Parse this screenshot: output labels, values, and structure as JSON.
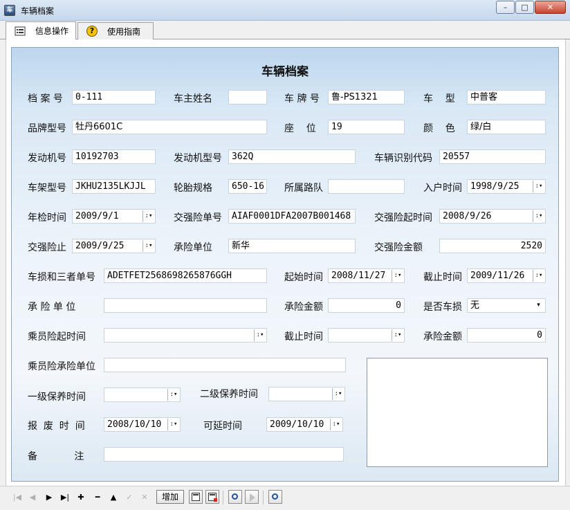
{
  "window": {
    "title": "车辆档案",
    "app_icon_text": "车",
    "minimize": "–",
    "maximize": "□",
    "close": "✕"
  },
  "tabs": [
    {
      "label": "信息操作",
      "icon": "list-icon"
    },
    {
      "label": "使用指南",
      "icon": "help-icon",
      "icon_glyph": "?"
    }
  ],
  "form": {
    "title": "车辆档案",
    "labels": {
      "file_no": "档 案 号",
      "owner_name": "车主姓名",
      "plate_no": "车 牌 号",
      "car_type": "车    型",
      "brand_model": "品牌型号",
      "seats": "座    位",
      "color": "颜    色",
      "engine_no": "发动机号",
      "engine_model": "发动机型号",
      "vin": "车辆识别代码",
      "frame_model": "车架型号",
      "tire_spec": "轮胎规格",
      "route_team": "所属路队",
      "entry_date": "入户时间",
      "inspection_date": "年检时间",
      "compulsory_no": "交强险单号",
      "compulsory_start": "交强险起时间",
      "compulsory_end": "交强险止",
      "insurer": "承险单位",
      "compulsory_amount": "交强险金额",
      "damage_third_no": "车损和三者单号",
      "start_date": "起始时间",
      "end_date": "截止时间",
      "insurer2": "承 险 单 位",
      "insured_amount": "承险金额",
      "vehicle_damage": "是否车损",
      "passenger_start": "乘员险起时间",
      "passenger_end": "截止时间",
      "passenger_amount": "承险金额",
      "passenger_insurer": "乘员险承险单位",
      "maintenance1": "一级保养时间",
      "maintenance2": "二级保养时间",
      "scrap_date": "报  废  时  间",
      "extend_date": "可延时间",
      "remarks": "备            注"
    },
    "values": {
      "file_no": "0-111",
      "owner_name": "",
      "plate_no": "鲁-PS1321",
      "car_type": "中普客",
      "brand_model": "牡丹6601C",
      "seats": "19",
      "color": "绿/白",
      "engine_no": "10192703",
      "engine_model": "362Q",
      "vin": "20557",
      "frame_model": "JKHU2135LKJJL",
      "tire_spec": "650-16",
      "route_team": "",
      "entry_date": "1998/9/25",
      "inspection_date": "2009/9/1",
      "compulsory_no": "AIAF0001DFA2007B001468",
      "compulsory_start": "2008/9/26",
      "compulsory_end": "2009/9/25",
      "insurer": "新华",
      "compulsory_amount": "2520",
      "damage_third_no": "ADETFET2568698265876GGH",
      "start_date": "2008/11/27",
      "end_date": "2009/11/26",
      "insurer2": "",
      "insured_amount": "0",
      "vehicle_damage": "无",
      "passenger_start": "",
      "passenger_end": "",
      "passenger_amount": "0",
      "passenger_insurer": "",
      "maintenance1": "",
      "maintenance2": "",
      "scrap_date": "2008/10/10",
      "extend_date": "2009/10/10",
      "remarks": ""
    },
    "dropdown_glyph": "▾",
    "date_dropdown_glyph": ":▾"
  },
  "navigator": {
    "first": "|◀",
    "prior": "◀",
    "next": "▶",
    "last": "▶|",
    "insert": "✚",
    "delete": "━",
    "edit": "▲",
    "post": "✓",
    "cancel": "✕",
    "add_label": "增加"
  }
}
